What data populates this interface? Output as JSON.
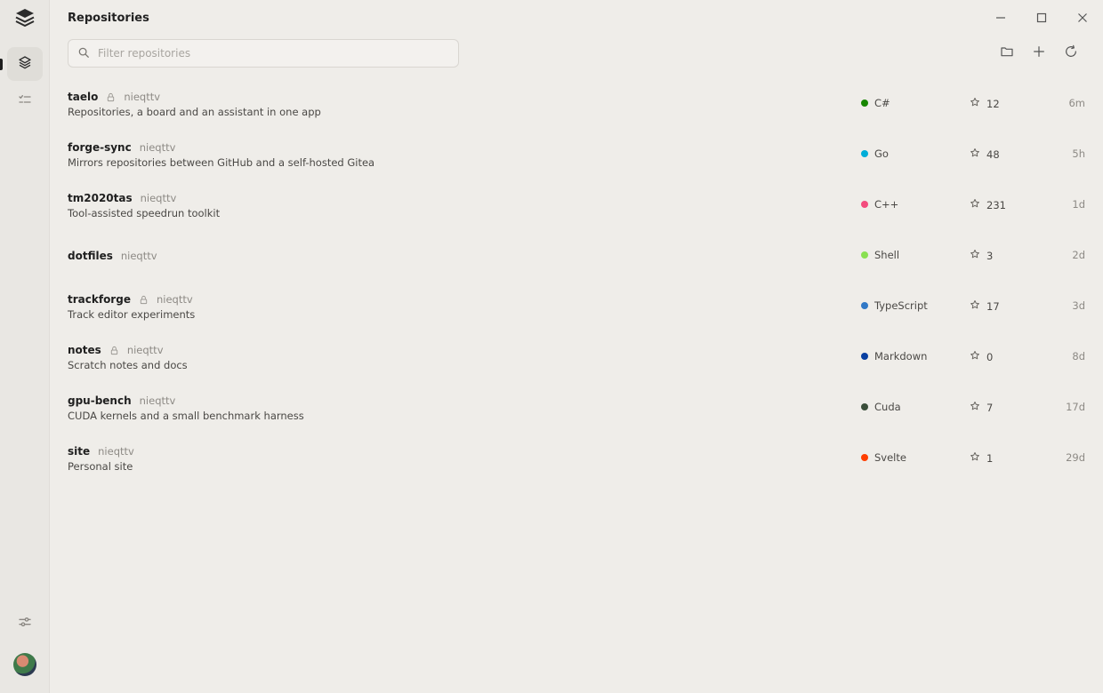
{
  "header": {
    "title": "Repositories"
  },
  "search": {
    "placeholder": "Filter repositories",
    "value": ""
  },
  "repos": [
    {
      "name": "taelo",
      "private": true,
      "owner": "nieqttv",
      "description": "Repositories, a board and an assistant in one app",
      "language": "C#",
      "lang_color": "#178600",
      "stars": "12",
      "age": "6m"
    },
    {
      "name": "forge-sync",
      "private": false,
      "owner": "nieqttv",
      "description": "Mirrors repositories between GitHub and a self-hosted Gitea",
      "language": "Go",
      "lang_color": "#00ADD8",
      "stars": "48",
      "age": "5h"
    },
    {
      "name": "tm2020tas",
      "private": false,
      "owner": "nieqttv",
      "description": "Tool-assisted speedrun toolkit",
      "language": "C++",
      "lang_color": "#f34b7d",
      "stars": "231",
      "age": "1d"
    },
    {
      "name": "dotfiles",
      "private": false,
      "owner": "nieqttv",
      "description": "",
      "language": "Shell",
      "lang_color": "#89e051",
      "stars": "3",
      "age": "2d"
    },
    {
      "name": "trackforge",
      "private": true,
      "owner": "nieqttv",
      "description": "Track editor experiments",
      "language": "TypeScript",
      "lang_color": "#3178c6",
      "stars": "17",
      "age": "3d"
    },
    {
      "name": "notes",
      "private": true,
      "owner": "nieqttv",
      "description": "Scratch notes and docs",
      "language": "Markdown",
      "lang_color": "#083fa1",
      "stars": "0",
      "age": "8d"
    },
    {
      "name": "gpu-bench",
      "private": false,
      "owner": "nieqttv",
      "description": "CUDA kernels and a small benchmark harness",
      "language": "Cuda",
      "lang_color": "#3A4E3A",
      "stars": "7",
      "age": "17d"
    },
    {
      "name": "site",
      "private": false,
      "owner": "nieqttv",
      "description": "Personal site",
      "language": "Svelte",
      "lang_color": "#ff3e00",
      "stars": "1",
      "age": "29d"
    }
  ]
}
